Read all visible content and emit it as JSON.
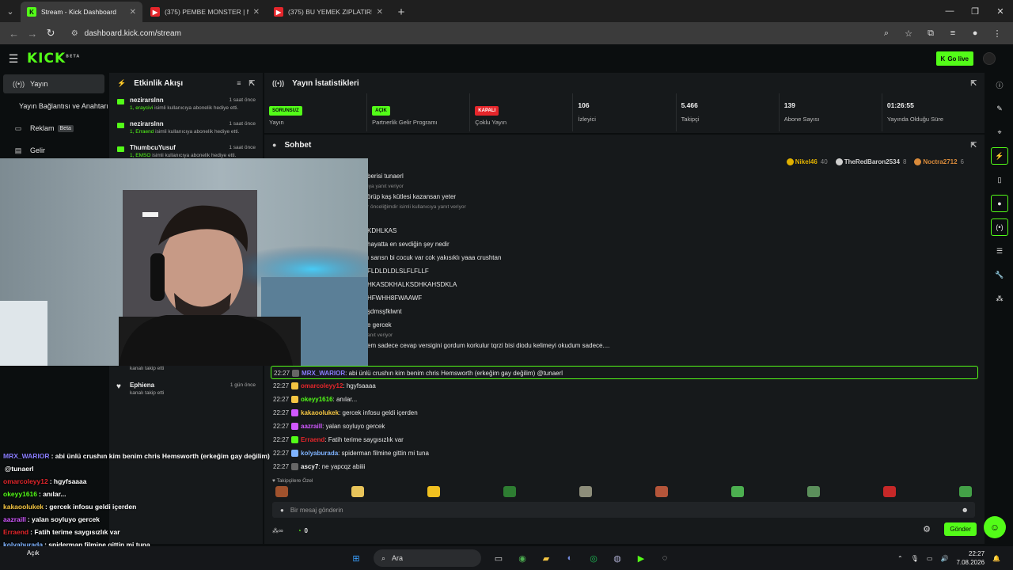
{
  "browser": {
    "tabs": [
      {
        "title": "Stream - Kick Dashboard",
        "favicon": "kick"
      },
      {
        "title": "(375) PEMBE MONSTER | Mada",
        "favicon": "youtube"
      },
      {
        "title": "(375) BU YEMEK ZIPLATIR! ELR",
        "favicon": "youtube"
      }
    ],
    "url": "dashboard.kick.com/stream"
  },
  "kick": {
    "logo": "KICK",
    "logo_sup": "BETA",
    "go_live": "Go live",
    "nav": [
      {
        "label": "Yayın",
        "icon": "broadcast-icon"
      },
      {
        "label": "Yayın Bağlantısı ve Anahtarı",
        "icon": ""
      },
      {
        "label": "Reklam",
        "icon": "ad-icon",
        "badge": "Beta"
      },
      {
        "label": "Gelir",
        "icon": "revenue-icon"
      }
    ]
  },
  "activity": {
    "title": "Etkinlik Akışı",
    "items": [
      {
        "name": "nezirarslnn",
        "time": "1 saat önce",
        "desc_pre": "1, ",
        "desc_user": "eraycivi",
        "desc": " isimli kullanıcıya abonelik hediye etti."
      },
      {
        "name": "nezirarslnn",
        "time": "1 saat önce",
        "desc_pre": "1, ",
        "desc_user": "Erraend",
        "desc": " isimli kullanıcıya abonelik hediye etti."
      },
      {
        "name": "ThumbcuYusuf",
        "time": "1 saat önce",
        "desc_pre": "1, ",
        "desc_user": "EMSO",
        "desc": " isimli kullanıcıya abonelik hediye etti."
      }
    ],
    "partial_desc": "kanalı takip etti",
    "last": {
      "name": "Ephiena",
      "time": "1 gün önce",
      "desc": "kanalı takip etti"
    }
  },
  "stats": {
    "title": "Yayın İstatistikleri",
    "cells": [
      {
        "pill": "SORUNSUZ",
        "pill_color": "#53fc18",
        "label": "Yayın"
      },
      {
        "pill": "AÇIK",
        "pill_color": "#53fc18",
        "label": "Partnerlik Gelir Programı"
      },
      {
        "pill": "KAPALI",
        "pill_color": "#e5262b",
        "label": "Çoklu Yayın"
      },
      {
        "value": "106",
        "label": "İzleyici"
      },
      {
        "value": "5.466",
        "label": "Takipçi"
      },
      {
        "value": "139",
        "label": "Abone Sayısı"
      },
      {
        "value": "01:26:55",
        "label": "Yayında Olduğu Süre"
      }
    ]
  },
  "chat": {
    "title": "Sohbet",
    "top_gifters": [
      {
        "name": "Nikel46",
        "count": "40",
        "color": "#e0b000"
      },
      {
        "name": "TheRedBaron2534",
        "count": "8",
        "color": "#cfcfcf"
      },
      {
        "name": "Noctra2712",
        "count": "6",
        "color": "#d98a3a"
      }
    ],
    "partial_lines": [
      {
        "text": "berisi tunaerl",
        "sub": false
      },
      {
        "text": "ıya yanıt veriyor",
        "sub": true
      },
      {
        "text": "örüp kaş kütlesi kazansan yeter",
        "sub": false
      },
      {
        "text": "r önceliğimdir isimli kullanıcıya yanıt veriyor",
        "sub": true
      },
      {
        "text": "",
        "sub": false
      },
      {
        "text": "KDHLKAS",
        "sub": false
      },
      {
        "text": "hayatta en sevdiğin şey nedir",
        "sub": false
      },
      {
        "text": "ı sarısn bi cocuk var cok yakısıklı yaaa crushtan",
        "sub": false
      },
      {
        "text": "FLDLDLDLSLFLFLLF",
        "sub": false
      },
      {
        "text": "HKASDKHALKSDHKAHSDKLA",
        "sub": false
      },
      {
        "text": "HFWHH8FWAAWF",
        "sub": false
      },
      {
        "text": "şdmsşfklwnt",
        "sub": false
      },
      {
        "text": "e gercek",
        "sub": false
      },
      {
        "text": "anıt veriyor",
        "sub": true
      },
      {
        "text": "em sadece cevap versigini gordum korkulur tqrzi bisi diodu kelimeyi okudum sadece....",
        "sub": false
      }
    ],
    "messages": [
      {
        "time": "22:27",
        "user": "MRX_WARIOR",
        "color": "#8a7dff",
        "text": ": abi ünlü crushın kim benim chris Hemsworth (erkeğim gay değilim) @tunaerl",
        "highlight": true
      },
      {
        "time": "22:27",
        "user": "omarcoleyy12",
        "color": "#e5262b",
        "text": ": hgyfsaaaa",
        "highlight": false
      },
      {
        "time": "22:27",
        "user": "okeyy1616",
        "color": "#53fc18",
        "text": ": anılar...",
        "highlight": false
      },
      {
        "time": "22:27",
        "user": "kakaoolukek",
        "color": "#f4c542",
        "text": ": gercek infosu geldi içerden",
        "highlight": false
      },
      {
        "time": "22:27",
        "user": "aazraill",
        "color": "#d158ff",
        "text": ": yalan soyluyo gercek",
        "highlight": false
      },
      {
        "time": "22:27",
        "user": "Erraend",
        "color": "#e5262b",
        "text": ": Fatih terime saygısızlık var",
        "highlight": false
      },
      {
        "time": "22:27",
        "user": "kolyaburada",
        "color": "#7fb3ff",
        "text": ": spiderman filmine gittin mi tuna",
        "highlight": false
      },
      {
        "time": "22:27",
        "user": "ascy7",
        "color": "#f0f0f0",
        "text": ": ne yapcqz abiiii",
        "highlight": false
      }
    ],
    "followers_only": "Takipçilere Özel",
    "input_placeholder": "Bir mesaj gönderin",
    "points": "0",
    "send": "Gönder"
  },
  "overlay_chat": [
    {
      "user": "MRX_WARIOR",
      "color": "#8a7dff",
      "text": ": abi ünlü crushın kim benim chris Hemsworth (erkeğim gay değilim)"
    },
    {
      "user": "",
      "color": "#8a7dff",
      "text": "@tunaerl"
    },
    {
      "user": "omarcoleyy12",
      "color": "#e5262b",
      "text": ": hgyfsaaaa"
    },
    {
      "user": "okeyy1616",
      "color": "#53fc18",
      "text": ": anılar..."
    },
    {
      "user": "kakaoolukek",
      "color": "#f4c542",
      "text": ": gercek infosu geldi içerden"
    },
    {
      "user": "aazraill",
      "color": "#d158ff",
      "text": ": yalan soyluyo gercek"
    },
    {
      "user": "Erraend",
      "color": "#e5262b",
      "text": ": Fatih terime saygısızlık var"
    },
    {
      "user": "kolyaburada",
      "color": "#7fb3ff",
      "text": ": spiderman filmine gittin mi tuna"
    },
    {
      "user": "ascy7",
      "color": "#f0f0f0",
      "text": ": ne yapcqz abiiii"
    }
  ],
  "taskbar": {
    "weather": "",
    "weather_sub": "Açık",
    "search": "Ara",
    "time": "22:27",
    "date": "7.08.2026"
  }
}
